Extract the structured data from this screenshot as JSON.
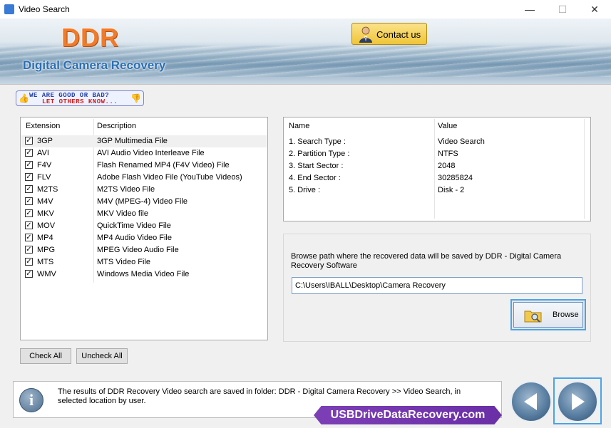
{
  "window": {
    "title": "Video Search",
    "minimize": "—",
    "maximize": "☐",
    "close": "✕"
  },
  "header": {
    "logo": "DDR",
    "subtitle": "Digital Camera Recovery",
    "contact_label": "Contact us"
  },
  "feedback": {
    "line1": "WE ARE GOOD OR BAD?",
    "line2": "LET OTHERS KNOW..."
  },
  "extensions": {
    "col_ext": "Extension",
    "col_desc": "Description",
    "rows": [
      {
        "ext": "3GP",
        "desc": "3GP Multimedia File",
        "checked": true
      },
      {
        "ext": "AVI",
        "desc": "AVI Audio Video Interleave File",
        "checked": true
      },
      {
        "ext": "F4V",
        "desc": "Flash Renamed MP4 (F4V Video) File",
        "checked": true
      },
      {
        "ext": "FLV",
        "desc": "Adobe Flash Video File (YouTube Videos)",
        "checked": true
      },
      {
        "ext": "M2TS",
        "desc": "M2TS Video File",
        "checked": true
      },
      {
        "ext": "M4V",
        "desc": "M4V (MPEG-4) Video File",
        "checked": true
      },
      {
        "ext": "MKV",
        "desc": "MKV Video file",
        "checked": true
      },
      {
        "ext": "MOV",
        "desc": "QuickTime Video File",
        "checked": true
      },
      {
        "ext": "MP4",
        "desc": "MP4 Audio Video File",
        "checked": true
      },
      {
        "ext": "MPG",
        "desc": "MPEG Video Audio File",
        "checked": true
      },
      {
        "ext": "MTS",
        "desc": "MTS Video File",
        "checked": true
      },
      {
        "ext": "WMV",
        "desc": "Windows Media Video File",
        "checked": true
      }
    ],
    "check_all": "Check All",
    "uncheck_all": "Uncheck All"
  },
  "info": {
    "col_name": "Name",
    "col_value": "Value",
    "rows": [
      {
        "name": "1. Search Type :",
        "value": "Video Search"
      },
      {
        "name": "2. Partition Type :",
        "value": "NTFS"
      },
      {
        "name": "3. Start Sector :",
        "value": "2048"
      },
      {
        "name": "4. End Sector :",
        "value": "30285824"
      },
      {
        "name": "5. Drive :",
        "value": "Disk - 2"
      }
    ]
  },
  "browse": {
    "text": "Browse path where the recovered data will be saved by DDR - Digital Camera Recovery Software",
    "path": "C:\\Users\\IBALL\\Desktop\\Camera Recovery",
    "button_label": "Browse"
  },
  "footer": {
    "message": "The results of DDR Recovery Video search are saved in folder: DDR - Digital Camera Recovery  >> Video Search, in selected location by user.",
    "watermark": "USBDriveDataRecovery.com"
  }
}
